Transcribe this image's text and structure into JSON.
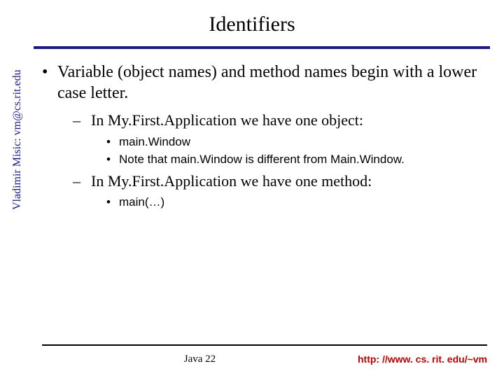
{
  "title": "Identifiers",
  "bullets": {
    "lvl1_0": "Variable (object names) and method names begin with a lower case letter.",
    "lvl2_0": "In My.First.Application we have one object:",
    "lvl3_0": "main.Window",
    "lvl3_1": "Note that main.Window is different from Main.Window.",
    "lvl2_1": "In My.First.Application we have one method:",
    "lvl3_2": "main(…)"
  },
  "sidebar": "Vladimir Misic: vm@cs.rit.edu",
  "footer": {
    "center": "Java 22",
    "right": "http: //www. cs. rit. edu/~vm"
  }
}
